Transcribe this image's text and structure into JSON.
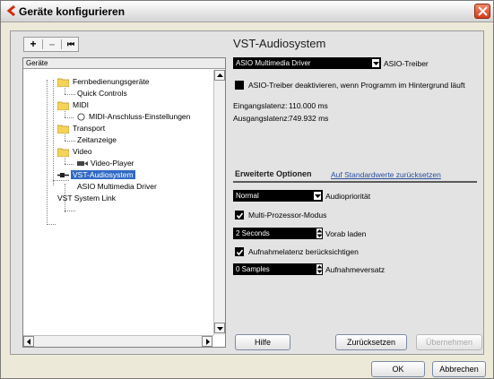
{
  "window": {
    "title": "Geräte konfigurieren"
  },
  "toolbar": {
    "add": "+",
    "remove": "–",
    "reset": "⏮"
  },
  "tree": {
    "header": "Geräte",
    "items": [
      {
        "label": "Fernbedienungsgeräte"
      },
      {
        "label": "Quick Controls"
      },
      {
        "label": "MIDI"
      },
      {
        "label": "MIDI-Anschluss-Einstellungen"
      },
      {
        "label": "Transport"
      },
      {
        "label": "Zeitanzeige"
      },
      {
        "label": "Video"
      },
      {
        "label": "Video-Player"
      },
      {
        "label": "VST-Audiosystem"
      },
      {
        "label": "ASIO Multimedia Driver"
      },
      {
        "label": "VST System Link"
      }
    ]
  },
  "panel": {
    "heading": "VST-Audiosystem",
    "asio_driver_value": "ASIO Multimedia Driver",
    "asio_driver_label": "ASIO-Treiber",
    "deactivate_label": "ASIO-Treiber deaktivieren, wenn Programm im Hintergrund läuft",
    "input_latency_label": "Eingangslatenz:",
    "input_latency_value": "110.000 ms",
    "output_latency_label": "Ausgangslatenz:",
    "output_latency_value": "749.932 ms",
    "advanced_title": "Erweiterte Optionen",
    "reset_link": "Auf Standardwerte zurücksetzen",
    "priority_value": "Normal",
    "priority_label": "Audiopriorität",
    "multiproc_label": "Multi-Prozessor-Modus",
    "preload_value": "2 Seconds",
    "preload_label": "Vorab laden",
    "record_latency_label": "Aufnahmelatenz berücksichtigen",
    "record_offset_value": "0 Samples",
    "record_offset_label": "Aufnahmeversatz"
  },
  "buttons": {
    "help": "Hilfe",
    "reset": "Zurücksetzen",
    "apply": "Übernehmen",
    "ok": "OK",
    "cancel": "Abbrechen"
  },
  "colors": {
    "selection": "#316ac5",
    "link": "#2a4e9e",
    "close": "#d63a1a"
  }
}
